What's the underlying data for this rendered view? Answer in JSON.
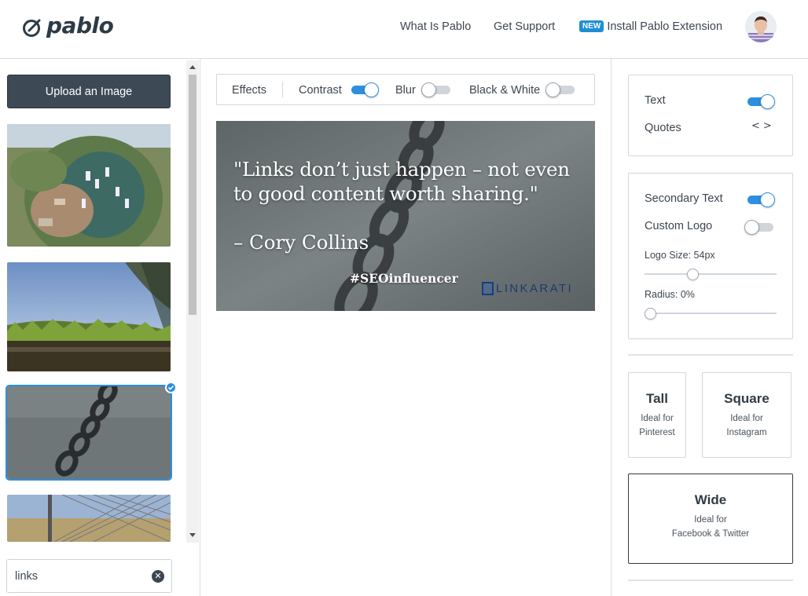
{
  "header": {
    "logo_text": "pablo",
    "nav": [
      "What Is Pablo",
      "Get Support"
    ],
    "install_badge": "NEW",
    "install_label": "Install Pablo Extension"
  },
  "sidebar": {
    "upload_label": "Upload an Image",
    "search_value": "links"
  },
  "effects": {
    "label": "Effects",
    "contrast_label": "Contrast",
    "blur_label": "Blur",
    "bw_label": "Black & White",
    "contrast_on": true,
    "blur_on": false,
    "bw_on": false
  },
  "canvas": {
    "quote_line1": "\"Links don’t just happen – not even",
    "quote_line2": "to good content worth sharing.\"",
    "author": "– Cory Collins",
    "hashtag": "#SEOinfluencer",
    "brand": "LINKARATI"
  },
  "right": {
    "text_label": "Text",
    "text_on": true,
    "quotes_label": "Quotes",
    "secondary_label": "Secondary Text",
    "secondary_on": true,
    "logo_label": "Custom Logo",
    "logo_on": false,
    "logo_size_label": "Logo Size: 54px",
    "logo_size_value": 54,
    "radius_label": "Radius: 0%",
    "radius_value": 0
  },
  "sizes": [
    {
      "title": "Tall",
      "sub1": "Ideal for",
      "sub2": "Pinterest"
    },
    {
      "title": "Square",
      "sub1": "Ideal for",
      "sub2": "Instagram"
    },
    {
      "title": "Wide",
      "sub1": "Ideal for",
      "sub2": "Facebook & Twitter"
    }
  ],
  "colors": {
    "accent": "#2d8fe0",
    "dark": "#3d4a56"
  }
}
